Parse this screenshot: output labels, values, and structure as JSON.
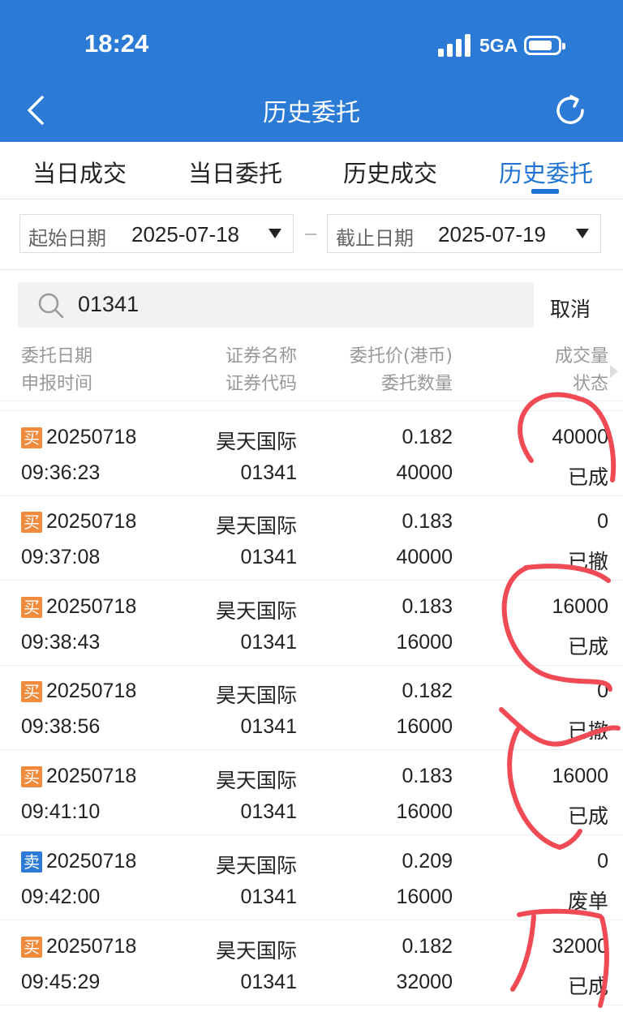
{
  "status_bar": {
    "time": "18:24",
    "network": "5GA"
  },
  "header": {
    "title": "历史委托"
  },
  "tabs": [
    {
      "label": "当日成交",
      "active": false
    },
    {
      "label": "当日委托",
      "active": false
    },
    {
      "label": "历史成交",
      "active": false
    },
    {
      "label": "历史委托",
      "active": true
    }
  ],
  "date_filter": {
    "start_label": "起始日期",
    "start_value": "2025-07-18",
    "end_label": "截止日期",
    "end_value": "2025-07-19"
  },
  "search": {
    "value": "01341",
    "cancel_label": "取消"
  },
  "columns": {
    "c1_line1": "委托日期",
    "c1_line2": "申报时间",
    "c2_line1": "证券名称",
    "c2_line2": "证券代码",
    "c3_line1": "委托价(港币)",
    "c3_line2": "委托数量",
    "c4_line1": "成交量",
    "c4_line2": "状态"
  },
  "orders": [
    {
      "side": "买",
      "side_type": "buy",
      "date": "20250718",
      "time": "09:36:23",
      "name": "昊天国际",
      "code": "01341",
      "price": "0.182",
      "qty": "40000",
      "filled": "40000",
      "status": "已成"
    },
    {
      "side": "买",
      "side_type": "buy",
      "date": "20250718",
      "time": "09:37:08",
      "name": "昊天国际",
      "code": "01341",
      "price": "0.183",
      "qty": "40000",
      "filled": "0",
      "status": "已撤"
    },
    {
      "side": "买",
      "side_type": "buy",
      "date": "20250718",
      "time": "09:38:43",
      "name": "昊天国际",
      "code": "01341",
      "price": "0.183",
      "qty": "16000",
      "filled": "16000",
      "status": "已成"
    },
    {
      "side": "买",
      "side_type": "buy",
      "date": "20250718",
      "time": "09:38:56",
      "name": "昊天国际",
      "code": "01341",
      "price": "0.182",
      "qty": "16000",
      "filled": "0",
      "status": "已撤"
    },
    {
      "side": "买",
      "side_type": "buy",
      "date": "20250718",
      "time": "09:41:10",
      "name": "昊天国际",
      "code": "01341",
      "price": "0.183",
      "qty": "16000",
      "filled": "16000",
      "status": "已成"
    },
    {
      "side": "卖",
      "side_type": "sell",
      "date": "20250718",
      "time": "09:42:00",
      "name": "昊天国际",
      "code": "01341",
      "price": "0.209",
      "qty": "16000",
      "filled": "0",
      "status": "废单"
    },
    {
      "side": "买",
      "side_type": "buy",
      "date": "20250718",
      "time": "09:45:29",
      "name": "昊天国际",
      "code": "01341",
      "price": "0.182",
      "qty": "32000",
      "filled": "32000",
      "status": "已成"
    }
  ],
  "colors": {
    "header_bg": "#2a7ad6",
    "active_tab": "#1e73d2",
    "buy_badge": "#f08a3c",
    "sell_badge": "#2a7ad6",
    "annotation": "#f04a55"
  }
}
